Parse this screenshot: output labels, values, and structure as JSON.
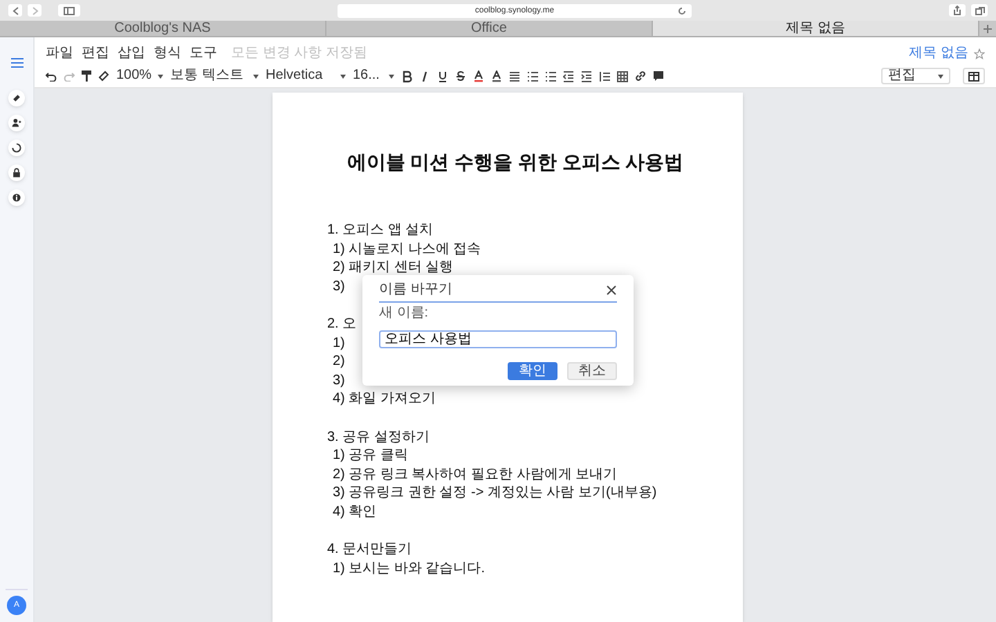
{
  "browser": {
    "url": "coolblog.synology.me",
    "tabs": [
      {
        "label": "Coolblog's NAS",
        "selected": false
      },
      {
        "label": "Office",
        "selected": false
      },
      {
        "label": "제목 없음",
        "selected": true
      }
    ]
  },
  "menu": {
    "items": [
      "파일",
      "편집",
      "삽입",
      "형식",
      "도구"
    ],
    "save_status": "모든 변경 사항 저장됨"
  },
  "toolbar": {
    "zoom": "100%",
    "paragraph_style": "보통 텍스트",
    "font": "Helvetica",
    "font_size": "16..."
  },
  "doc_name": "제목 없음",
  "mode": "편집",
  "sidebar": {
    "avatar": "A"
  },
  "document": {
    "title": "에이블 미션 수행을 위한 오피스 사용법",
    "lines": [
      {
        "kind": "heading",
        "text": "1. 오피스 앱 설치"
      },
      {
        "kind": "item",
        "text": "1) 시놀로지 나스에 접속"
      },
      {
        "kind": "item",
        "text": "2) 패키지 센터 실행"
      },
      {
        "kind": "item",
        "text": "3)"
      },
      {
        "kind": "gap"
      },
      {
        "kind": "heading",
        "text": "2. 오"
      },
      {
        "kind": "item",
        "text": "1)"
      },
      {
        "kind": "item",
        "text": "2)"
      },
      {
        "kind": "item",
        "text": "3)"
      },
      {
        "kind": "item",
        "text": "4) 화일 가져오기"
      },
      {
        "kind": "gap"
      },
      {
        "kind": "heading",
        "text": "3. 공유 설정하기"
      },
      {
        "kind": "item",
        "text": "1) 공유 클릭"
      },
      {
        "kind": "item",
        "text": "2) 공유 링크 복사하여 필요한 사람에게 보내기"
      },
      {
        "kind": "item",
        "text": "3) 공유링크 권한 설정 -> 계정있는 사람 보기(내부용)"
      },
      {
        "kind": "item",
        "text": "4) 확인"
      },
      {
        "kind": "gap"
      },
      {
        "kind": "heading",
        "text": "4. 문서만들기"
      },
      {
        "kind": "item",
        "text": "1) 보시는 바와 같습니다."
      }
    ]
  },
  "dialog": {
    "title": "이름 바꾸기",
    "label": "새 이름:",
    "value": "오피스 사용법",
    "buttons": [
      {
        "kind": "primary",
        "label": "확인"
      },
      {
        "kind": "secondary",
        "label": "취소"
      }
    ]
  }
}
